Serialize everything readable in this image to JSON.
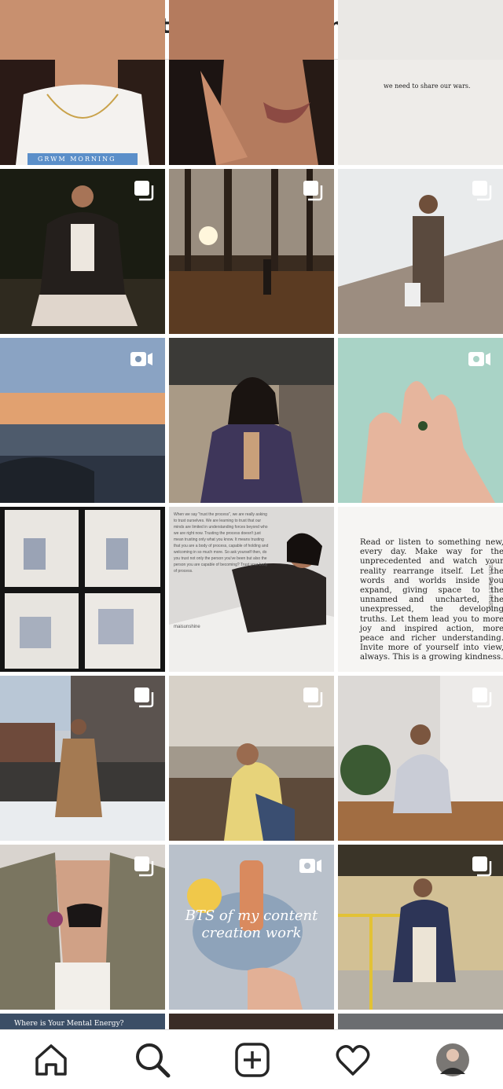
{
  "header": {
    "title": "littlemaisunshine"
  },
  "tiles": [
    {
      "caption": "GRWM MORNING"
    },
    {
      "caption": ""
    },
    {
      "caption": "we need to share our wars."
    },
    {
      "caption": ""
    },
    {
      "caption": ""
    },
    {
      "caption": ""
    },
    {
      "caption": ""
    },
    {
      "caption": ""
    },
    {
      "caption": ""
    },
    {
      "caption": ""
    },
    {
      "caption": "When we say \"trust the process\", we are really asking to trust ourselves. We are learning to trust that our minds are limited in understanding forces beyond who we are right now. Trusting the process doesn't just mean trusting only what you know. It means trusting that you are a body of process, capable of holding and welcoming in so much more. So ask yourself then, do you trust not only the person you've been but also the person you are capable of becoming? Trust your body of process."
    },
    {
      "caption": "Read or listen to something new, every day. Make way for the unprecedented and watch your reality rearrange itself. Let the words and worlds inside you expand, giving space to the unnamed and uncharted, the unexpressed, the developing truths. Let them lead you to more joy and inspired action, more peace and richer understanding. Invite more of yourself into view, always. This is a growing kindness.",
      "author": "YRSA DALEY-WARD"
    },
    {
      "caption": ""
    },
    {
      "caption": ""
    },
    {
      "caption": ""
    },
    {
      "caption": ""
    },
    {
      "caption": "BTS of my content creation work"
    },
    {
      "caption": ""
    },
    {
      "caption": "Where is Your Mental Energy?"
    }
  ],
  "sign": "maisunshine",
  "nav": [
    "home-icon",
    "search-icon",
    "new-post-icon",
    "activity-icon",
    "profile-avatar"
  ]
}
